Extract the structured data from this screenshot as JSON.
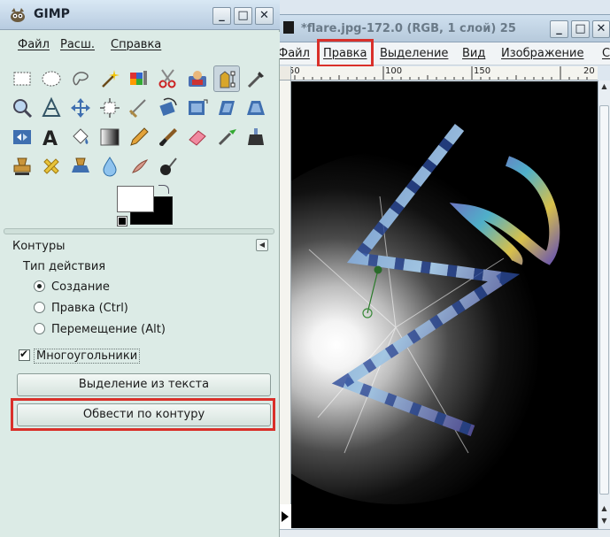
{
  "toolbox": {
    "title": "GIMP",
    "window_controls": {
      "minimize": "_",
      "maximize": "□",
      "close": "✕"
    },
    "menu": [
      {
        "label": "Файл"
      },
      {
        "label": "Расш."
      },
      {
        "label": "Справка"
      }
    ],
    "tools": [
      "rect-select-icon",
      "ellipse-select-icon",
      "free-select-icon",
      "fuzzy-select-icon",
      "color-select-icon",
      "scissors-icon",
      "foreground-select-icon",
      "paths-icon",
      "color-picker-icon",
      "zoom-icon",
      "measure-icon",
      "move-icon",
      "align-icon",
      "crop-icon",
      "rotate-icon",
      "scale-icon",
      "shear-icon",
      "perspective-icon",
      "flip-icon",
      "text-icon",
      "bucket-fill-icon",
      "blend-icon",
      "pencil-icon",
      "paintbrush-icon",
      "eraser-icon",
      "airbrush-icon",
      "ink-icon",
      "clone-icon",
      "heal-icon",
      "perspective-clone-icon",
      "blur-icon",
      "smudge-icon",
      "dodge-burn-icon"
    ],
    "active_tool_index": 7,
    "panel": {
      "title": "Контуры",
      "mode_label": "Тип действия",
      "modes": [
        {
          "label": "Создание",
          "selected": true
        },
        {
          "label": "Правка (Ctrl)",
          "selected": false
        },
        {
          "label": "Перемещение (Alt)",
          "selected": false
        }
      ],
      "polygonal_label": "Многоугольники",
      "polygonal_checked": true,
      "selection_from_text_label": "Выделение из текста",
      "stroke_path_label": "Обвести по контуру"
    }
  },
  "image_window": {
    "title": "*flare.jpg-172.0 (RGB, 1 слой) 25",
    "window_controls": {
      "minimize": "_",
      "maximize": "□",
      "close": "✕"
    },
    "menu": [
      {
        "label": "Файл"
      },
      {
        "label": "Правка"
      },
      {
        "label": "Выделение"
      },
      {
        "label": "Вид"
      },
      {
        "label": "Изображение"
      },
      {
        "label": "С"
      }
    ],
    "ruler_labels": [
      "50",
      "100",
      "150",
      "20"
    ]
  },
  "colors": {
    "highlight": "#d9302a",
    "toolbox_bg": "#dcebe6"
  }
}
